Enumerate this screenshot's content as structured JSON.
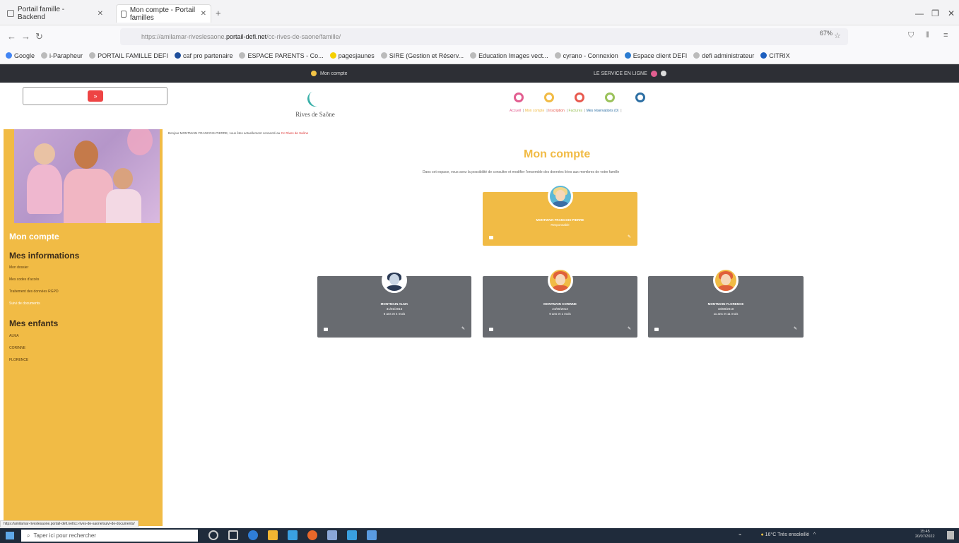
{
  "browser": {
    "tabs": [
      {
        "label": "Portail famille - Backend"
      },
      {
        "label": "Mon compte - Portail familles"
      }
    ],
    "url": {
      "prefix": "https://amilamar-riveslesaone.",
      "host": "portail-defi.net",
      "suffix": "/cc-rives-de-saone/famille/"
    },
    "zoom": "67%",
    "bookmarks": [
      "Google",
      "i-Parapheur",
      "PORTAIL FAMILLE DEFI",
      "caf pro partenaire",
      "ESPACE PARENTS - Co...",
      "pagesjaunes",
      "SIRE (Gestion et Réserv...",
      "Education Images vect...",
      "cyrano - Connexion",
      "Espace client DEFI",
      "defi administrateur",
      "CITRIX"
    ]
  },
  "darkstrip": {
    "left": "Mon compte",
    "right": "LE SERVICE EN LIGNE"
  },
  "header": {
    "search_button": "»",
    "logo_text": "Rives de Saône",
    "nav": [
      "Accueil",
      "Mon compte",
      "Inscription",
      "Factures",
      "Mes réservations (0)"
    ],
    "nav_colors": [
      "#e25e90",
      "#f1bb45",
      "#e85a4f",
      "#9bc25b",
      "#2d6fa3"
    ]
  },
  "sidebar": {
    "title": "Mon compte",
    "info_heading": "Mes informations",
    "info_links": [
      "Mon dossier",
      "Mes codes d'accès",
      "Traitement des données RGPD",
      "Suivi de documents"
    ],
    "kids_heading": "Mes enfants",
    "kids_links": [
      "ALMA",
      "CORINNE",
      "FLORENCE"
    ]
  },
  "main": {
    "notice": "Bonjour MONTMAIN FRANCOIS-PIERRE, vous êtes actuellement connecté au",
    "notice_link": "Cc Rives de Saône",
    "title": "Mon compte",
    "intro": "Dans cet espace, vous avez la possibilité de consulter et modifier l'ensemble des données liées aux membres de votre famille",
    "parent": {
      "name": "MONTMAIN FRANCOIS-PIERRE",
      "role": "Responsable"
    },
    "children": [
      {
        "name": "MONTMAIN ALMA",
        "birth": "31/01/2016",
        "age": "6 ans et 4 mois"
      },
      {
        "name": "MONTMAIN CORINNE",
        "birth": "24/06/2013",
        "age": "9 ans et 1 mois"
      },
      {
        "name": "MONTMAIN FLORENCE",
        "birth": "18/08/2010",
        "age": "11 ans et 11 mois"
      }
    ]
  },
  "status_url": "https://amilamar-riveslesaone.portail-defi.net/cc-rives-de-saone/suivi-de-documents/",
  "taskbar": {
    "search": "Taper ici pour rechercher",
    "weather": "16°C  Très ensoleillé",
    "time": "15:45",
    "date": "20/07/2022"
  }
}
